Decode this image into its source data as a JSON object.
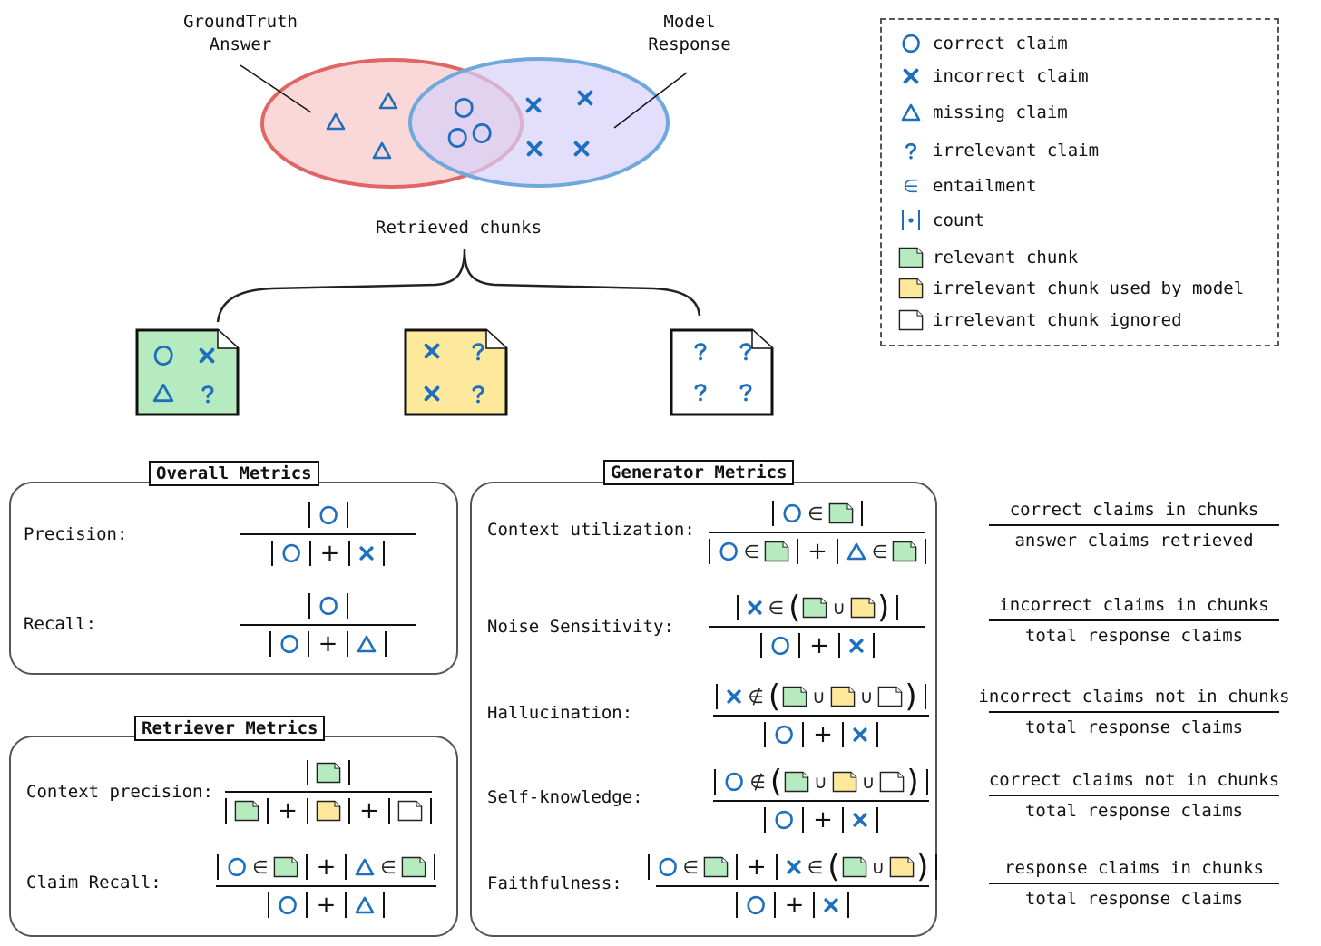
{
  "venn": {
    "ground_truth_label_line1": "GroundTruth",
    "ground_truth_label_line2": "Answer",
    "model_response_label_line1": "Model",
    "model_response_label_line2": "Response",
    "colors": {
      "ground_truth": "#e06666",
      "model_response": "#6fa8dc",
      "symbol": "#1f6fbf"
    },
    "ground_truth_only": [
      "missing",
      "missing",
      "missing"
    ],
    "intersection": [
      "correct",
      "correct",
      "correct"
    ],
    "model_only": [
      "incorrect",
      "incorrect",
      "incorrect",
      "incorrect"
    ]
  },
  "retrieved": {
    "label": "Retrieved chunks",
    "chunks": [
      {
        "type": "relevant",
        "color": "#b6ebbf",
        "claims": [
          "correct",
          "incorrect",
          "missing",
          "irrelevant"
        ]
      },
      {
        "type": "irrelevant-used",
        "color": "#fde89c",
        "claims": [
          "incorrect",
          "irrelevant",
          "incorrect",
          "irrelevant"
        ]
      },
      {
        "type": "irrelevant-ignored",
        "color": "#ffffff",
        "claims": [
          "irrelevant",
          "irrelevant",
          "irrelevant",
          "irrelevant"
        ]
      }
    ]
  },
  "legend": {
    "items": [
      {
        "icon": "correct-claim-circle",
        "label": "correct claim"
      },
      {
        "icon": "incorrect-claim-x",
        "label": "incorrect claim"
      },
      {
        "icon": "missing-claim-triangle",
        "label": "missing claim"
      },
      {
        "icon": "irrelevant-claim-question",
        "label": "irrelevant claim"
      },
      {
        "icon": "entailment-symbol",
        "label": "entailment"
      },
      {
        "icon": "count-symbol",
        "label": "count"
      },
      {
        "icon": "relevant-chunk",
        "label": "relevant chunk"
      },
      {
        "icon": "irrelevant-chunk-used",
        "label": "irrelevant chunk used by model"
      },
      {
        "icon": "irrelevant-chunk-ignored",
        "label": "irrelevant chunk ignored"
      }
    ]
  },
  "overall": {
    "title": "Overall Metrics",
    "precision_label": "Precision:",
    "recall_label": "Recall:"
  },
  "retriever": {
    "title": "Retriever Metrics",
    "context_precision_label": "Context precision:",
    "claim_recall_label": "Claim Recall:"
  },
  "generator": {
    "title": "Generator Metrics",
    "context_utilization_label": "Context utilization:",
    "noise_sensitivity_label": "Noise Sensitivity:",
    "hallucination_label": "Hallucination:",
    "self_knowledge_label": "Self-knowledge:",
    "faithfulness_label": "Faithfulness:"
  },
  "operators": {
    "plus": "+",
    "in": "∈",
    "not_in": "∉",
    "union": "∪",
    "lparen": "(",
    "rparen": ")"
  },
  "descriptions": [
    {
      "num": "correct claims in chunks",
      "den": "answer claims retrieved"
    },
    {
      "num": "incorrect claims in chunks",
      "den": "total response claims"
    },
    {
      "num": "incorrect claims not in chunks",
      "den": "total response claims"
    },
    {
      "num": "correct claims not in chunks",
      "den": "total response claims"
    },
    {
      "num": "response claims in chunks",
      "den": "total response claims"
    }
  ]
}
